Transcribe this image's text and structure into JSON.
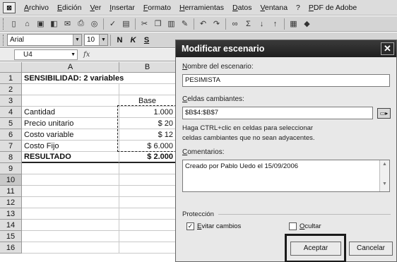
{
  "menu": {
    "items": [
      "Archivo",
      "Edición",
      "Ver",
      "Insertar",
      "Formato",
      "Herramientas",
      "Datos",
      "Ventana",
      "?",
      "PDF de Adobe"
    ]
  },
  "toolbar": {
    "icons": [
      "new-icon",
      "open-icon",
      "save-icon",
      "permission-icon",
      "mail-icon",
      "print-icon",
      "print-preview-icon",
      "spelling-icon",
      "research-icon",
      "cut-icon",
      "copy-icon",
      "paste-icon",
      "format-painter-icon",
      "undo-icon",
      "redo-icon",
      "hyperlink-icon",
      "autosum-icon",
      "sort-asc-icon",
      "sort-desc-icon",
      "chart-icon",
      "drawing-icon"
    ],
    "font_name": "Arial",
    "font_size": "10",
    "bold": "N",
    "italic": "K",
    "underline": "S"
  },
  "formula_bar": {
    "name_box": "U4",
    "fx": "fx",
    "content": ""
  },
  "sheet": {
    "columns": [
      "A",
      "B"
    ],
    "rows": [
      "1",
      "2",
      "3",
      "4",
      "5",
      "6",
      "7",
      "8",
      "9",
      "10",
      "11",
      "12",
      "13",
      "14",
      "15",
      "16"
    ],
    "selected_row": "10",
    "cells": {
      "a1": "SENSIBILIDAD: 2 variables",
      "b3": "Base",
      "a4": "Cantidad",
      "b4": "1.000",
      "a5": "Precio unitario",
      "b5": "$ 20",
      "a6": "Costo variable",
      "b6": "$ 12",
      "a7": "Costo Fijo",
      "b7": "$ 6.000",
      "a8": "RESULTADO",
      "b8": "$ 2.000"
    }
  },
  "dialog": {
    "title": "Modificar escenario",
    "close": "✕",
    "name_label": "Nombre del escenario:",
    "name_value": "PESIMISTA",
    "cells_label": "Celdas cambiantes:",
    "cells_value": "$B$4:$B$7",
    "hint_line1": "Haga CTRL+clic en celdas para seleccionar",
    "hint_line2": "celdas cambiantes que no sean adyacentes.",
    "comments_label": "Comentarios:",
    "comments_value": "Creado por Pablo Uedo el 15/09/2006",
    "protection_label": "Protección",
    "prevent_changes_label": "Evitar cambios",
    "prevent_changes_checked": "✓",
    "hide_label": "Ocultar",
    "ok_label": "Aceptar",
    "cancel_label": "Cancelar"
  }
}
